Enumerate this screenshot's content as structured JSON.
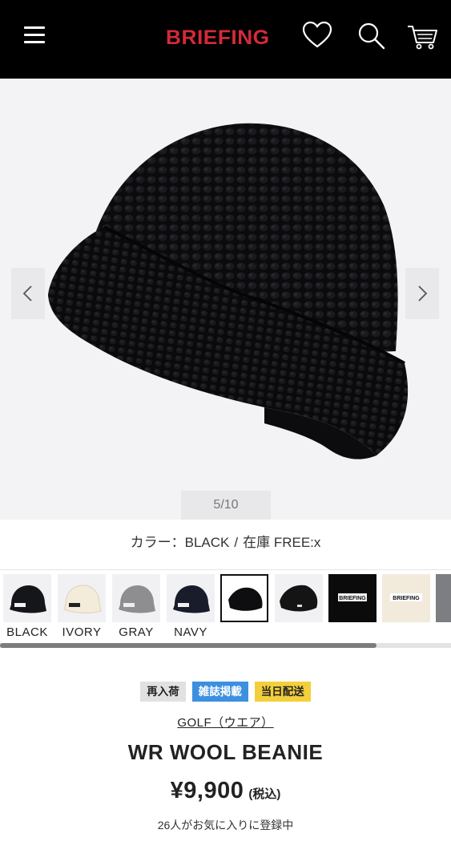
{
  "header": {
    "brand": "BRIEFING",
    "brand_color": "#d42a39",
    "icons": [
      "menu-icon",
      "heart-icon",
      "search-icon",
      "cart-icon"
    ]
  },
  "gallery": {
    "counter": "5/10",
    "prev_icon": "chevron-left-icon",
    "next_icon": "chevron-right-icon"
  },
  "variant": {
    "color_label": "カラー：BLACK",
    "separator": "/",
    "stock_label": "在庫 FREE:",
    "stock_status": "x"
  },
  "swatches": [
    {
      "label": "BLACK",
      "color": "#15161a"
    },
    {
      "label": "IVORY",
      "color": "#f3ecda"
    },
    {
      "label": "GRAY",
      "color": "#8e8e90"
    },
    {
      "label": "NAVY",
      "color": "#181c2b"
    },
    {
      "label": "",
      "color": "#0e0e10"
    },
    {
      "label": "",
      "color": "#141414"
    },
    {
      "label": "",
      "color": "#0b0b0b"
    },
    {
      "label": "",
      "color": "#f2eadb"
    },
    {
      "label": "",
      "color": "#7d7e82"
    }
  ],
  "swatch_logo_text": "BRIEFING",
  "badges": {
    "restock": "再入荷",
    "magazine": "雑誌掲載",
    "same_day": "当日配送"
  },
  "product": {
    "category": "GOLF（ウエア）",
    "name": "WR WOOL BEANIE",
    "price": "¥9,900",
    "tax_note": "(税込)",
    "favorites": "26人がお気に入りに登録中"
  }
}
